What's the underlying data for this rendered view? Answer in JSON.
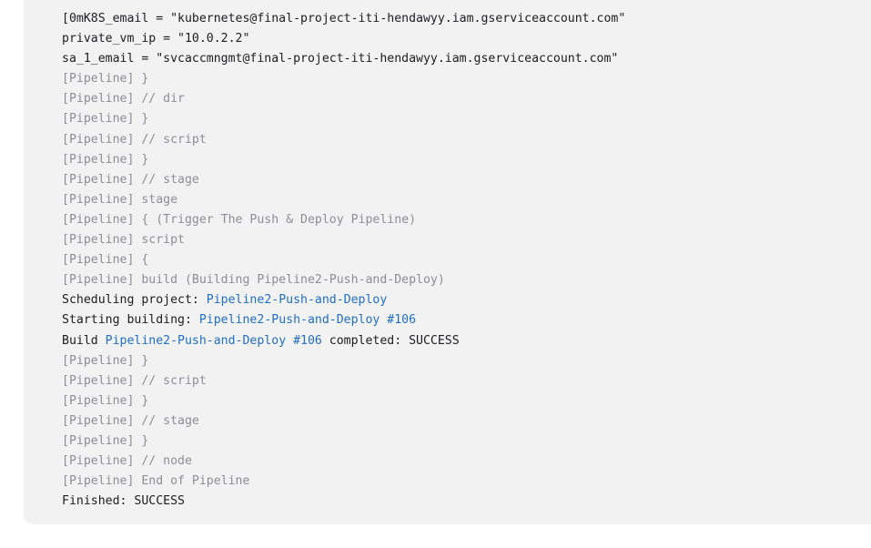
{
  "console": {
    "lines": [
      {
        "type": "plain",
        "text": "\u001b[0mK8S_email = \"kubernetes@final-project-iti-hendawyy.iam.gserviceaccount.com\""
      },
      {
        "type": "plain",
        "text": "private_vm_ip = \"10.0.2.2\""
      },
      {
        "type": "plain",
        "text": "sa_1_email = \"svcaccmngmt@final-project-iti-hendawyy.iam.gserviceaccount.com\""
      },
      {
        "type": "muted",
        "text": "[Pipeline] }"
      },
      {
        "type": "muted",
        "text": "[Pipeline] // dir"
      },
      {
        "type": "muted",
        "text": "[Pipeline] }"
      },
      {
        "type": "muted",
        "text": "[Pipeline] // script"
      },
      {
        "type": "muted",
        "text": "[Pipeline] }"
      },
      {
        "type": "muted",
        "text": "[Pipeline] // stage"
      },
      {
        "type": "muted",
        "text": "[Pipeline] stage"
      },
      {
        "type": "muted",
        "text": "[Pipeline] { (Trigger The Push & Deploy Pipeline)"
      },
      {
        "type": "muted",
        "text": "[Pipeline] script"
      },
      {
        "type": "muted",
        "text": "[Pipeline] {"
      },
      {
        "type": "muted",
        "text": "[Pipeline] build (Building Pipeline2-Push-and-Deploy)"
      },
      {
        "type": "link",
        "before": "Scheduling project: ",
        "link": "Pipeline2-Push-and-Deploy",
        "after": ""
      },
      {
        "type": "link",
        "before": "Starting building: ",
        "link": "Pipeline2-Push-and-Deploy #106",
        "after": ""
      },
      {
        "type": "link",
        "before": "Build ",
        "link": "Pipeline2-Push-and-Deploy #106",
        "after": " completed: SUCCESS"
      },
      {
        "type": "muted",
        "text": "[Pipeline] }"
      },
      {
        "type": "muted",
        "text": "[Pipeline] // script"
      },
      {
        "type": "muted",
        "text": "[Pipeline] }"
      },
      {
        "type": "muted",
        "text": "[Pipeline] // stage"
      },
      {
        "type": "muted",
        "text": "[Pipeline] }"
      },
      {
        "type": "muted",
        "text": "[Pipeline] // node"
      },
      {
        "type": "muted",
        "text": "[Pipeline] End of Pipeline"
      },
      {
        "type": "plain",
        "text": "Finished: SUCCESS"
      }
    ]
  }
}
